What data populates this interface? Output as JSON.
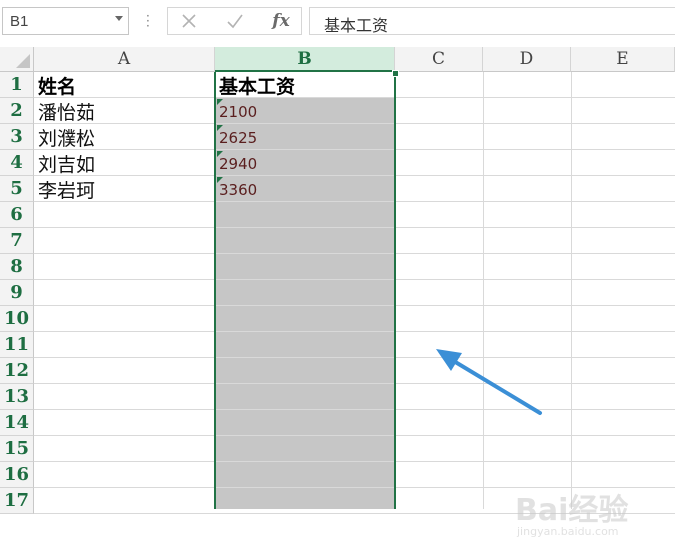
{
  "formula_bar": {
    "name_box": "B1",
    "cancel_icon": "close-icon",
    "enter_icon": "checkmark-icon",
    "fx_label": "fx",
    "formula_value": "基本工资"
  },
  "columns": [
    "A",
    "B",
    "C",
    "D",
    "E"
  ],
  "selected_column": "B",
  "rows": [
    "1",
    "2",
    "3",
    "4",
    "5",
    "6",
    "7",
    "8",
    "9",
    "10",
    "11",
    "12",
    "13",
    "14",
    "15",
    "16",
    "17"
  ],
  "cells": {
    "A1": "姓名",
    "B1": "基本工资",
    "A2": "潘怡茹",
    "B2": "2100",
    "A3": "刘濮松",
    "B3": "2625",
    "A4": "刘吉如",
    "B4": "2940",
    "A5": "李岩珂",
    "B5": "3360"
  },
  "colors": {
    "accent_green": "#217346",
    "selection_fill": "#c6c6c6",
    "arrow_blue": "#3b8fd6",
    "number_text": "#5a1e1e"
  },
  "watermark": {
    "logo_text": "Bai经验",
    "url_text": "jingyan.baidu.com"
  }
}
